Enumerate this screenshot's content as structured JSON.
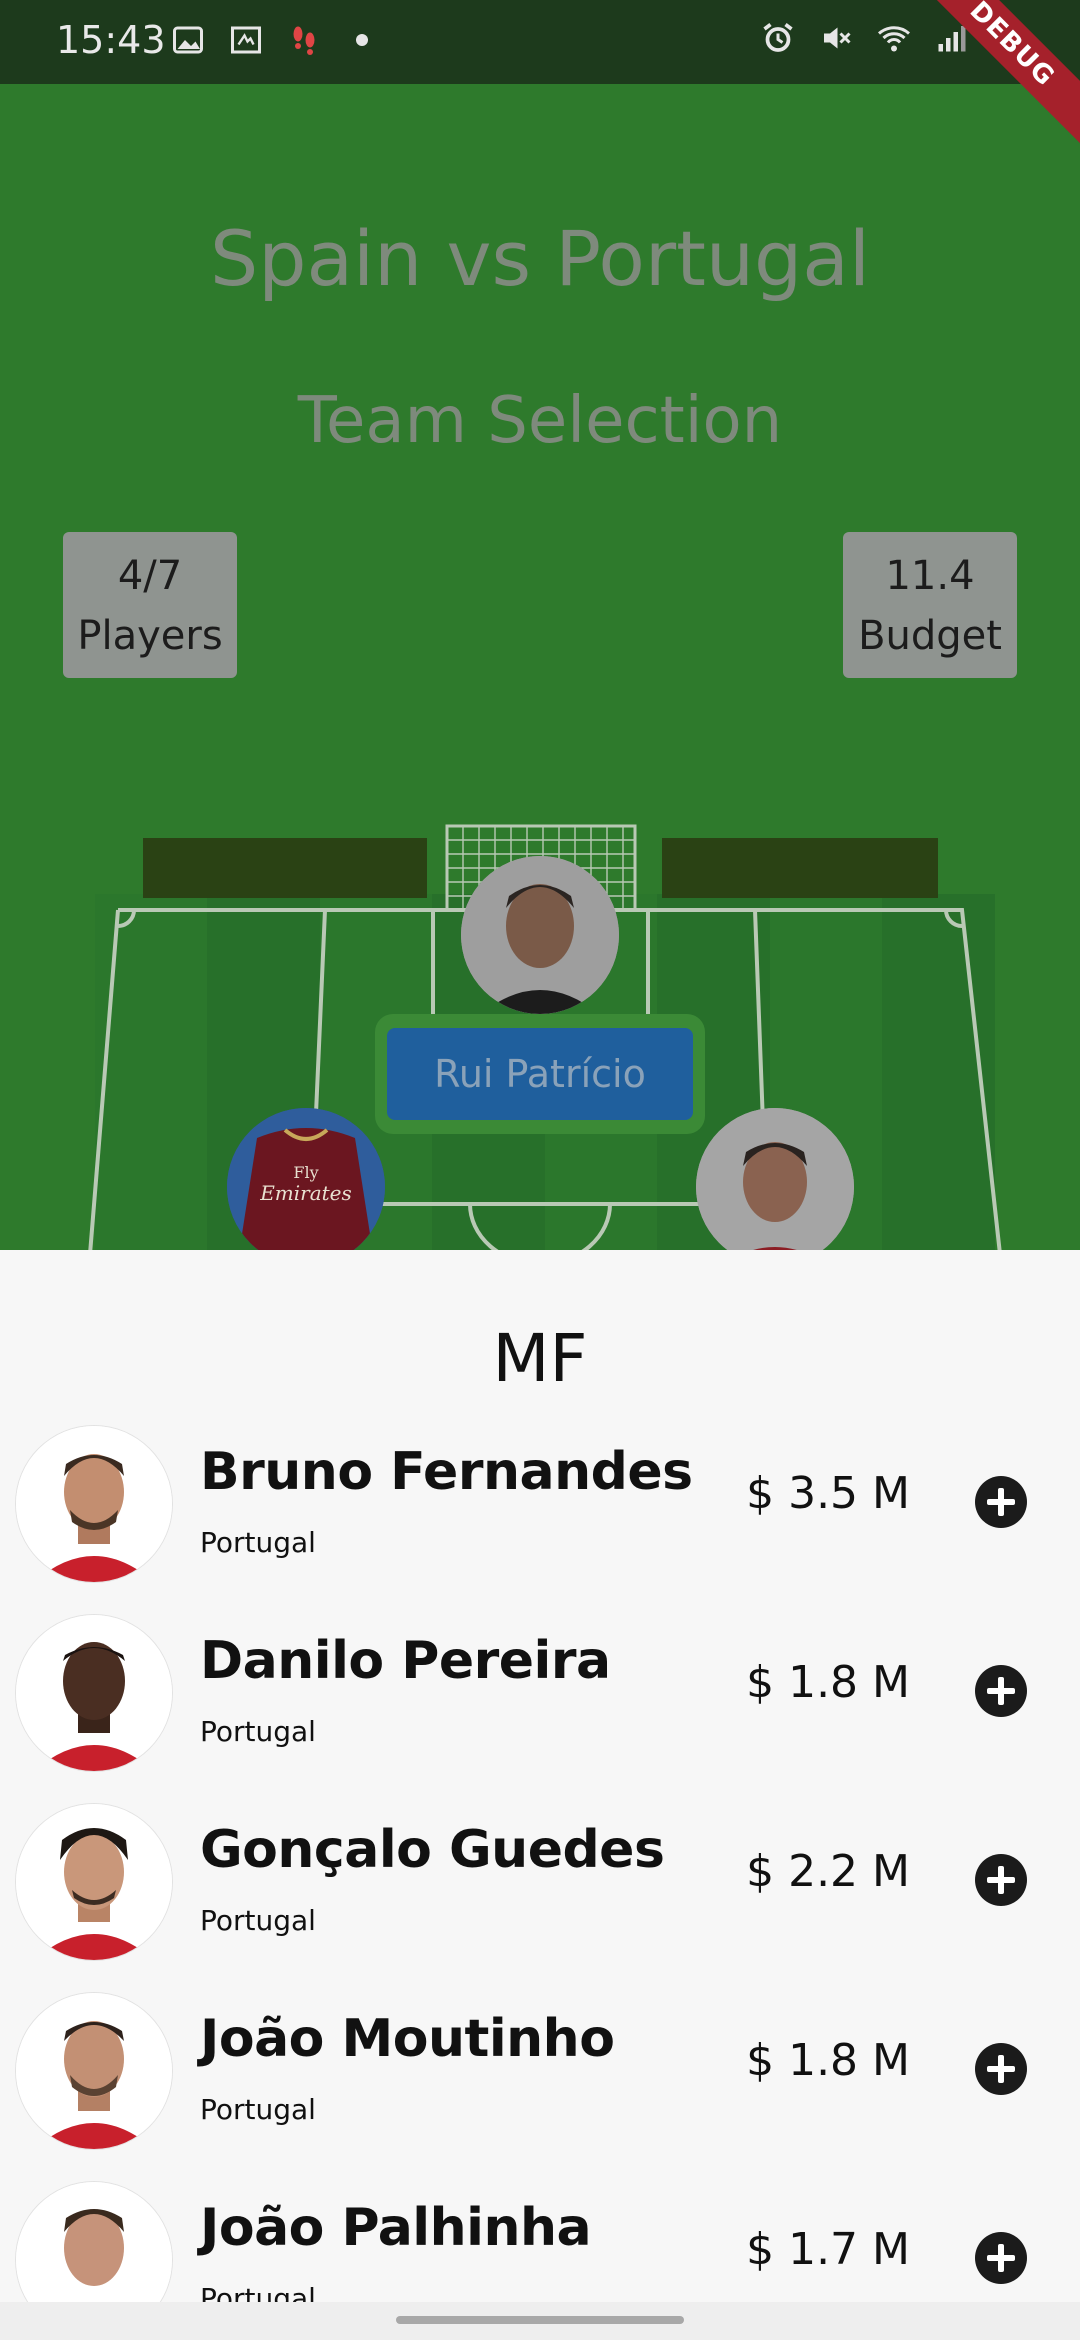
{
  "status_bar": {
    "time": "15:43",
    "left_icons": [
      "image-icon",
      "sim-icon",
      "footsteps-icon",
      "dot-icon"
    ],
    "right_icons": [
      "alarm-icon",
      "mute-icon",
      "wifi-icon",
      "signal-icon",
      "battery-icon"
    ],
    "debug_label": "DEBUG"
  },
  "header": {
    "match_title": "Spain vs Portugal",
    "subtitle": "Team Selection"
  },
  "stats": {
    "players_value": "4/7",
    "players_label": "Players",
    "budget_value": "11.4",
    "budget_label": "Budget"
  },
  "pitch": {
    "selected_player_name": "Rui Patrício"
  },
  "sheet": {
    "position_title": "MF",
    "players": [
      {
        "name": "Bruno Fernandes",
        "country": "Portugal",
        "price": "$ 3.5 M"
      },
      {
        "name": "Danilo Pereira",
        "country": "Portugal",
        "price": "$ 1.8 M"
      },
      {
        "name": "Gonçalo Guedes",
        "country": "Portugal",
        "price": "$ 2.2 M"
      },
      {
        "name": "João Moutinho",
        "country": "Portugal",
        "price": "$ 1.8 M"
      },
      {
        "name": "João Palhinha",
        "country": "Portugal",
        "price": "$ 1.7 M"
      }
    ]
  },
  "colors": {
    "pitch_green": "#2e7a2c",
    "status_bar": "#1d3a1c",
    "name_tag_blue": "#1f5f9d",
    "sheet_bg": "#f7f7f7",
    "debug_red": "#a5212b"
  }
}
